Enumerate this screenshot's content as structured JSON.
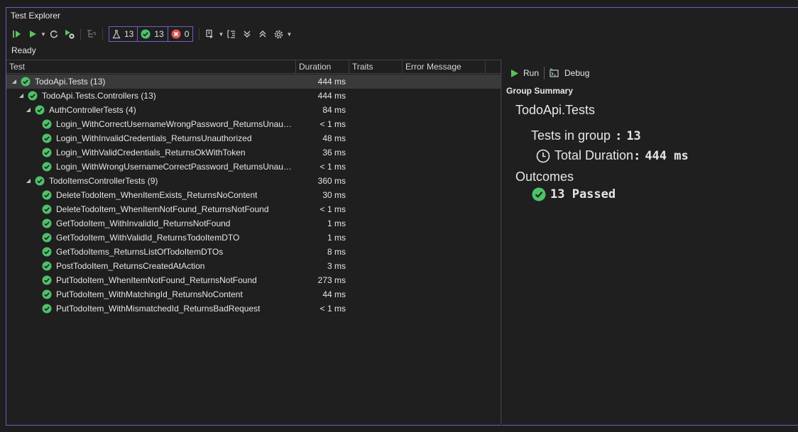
{
  "window": {
    "title": "Test Explorer"
  },
  "toolbar": {
    "counts": {
      "total": "13",
      "passed": "13",
      "failed": "0"
    }
  },
  "status": "Ready",
  "columns": {
    "test": "Test",
    "duration": "Duration",
    "traits": "Traits",
    "error": "Error Message"
  },
  "tree": [
    {
      "name": "TodoApi.Tests (13)",
      "duration": "444 ms",
      "level": 0,
      "expandable": true,
      "selected": true
    },
    {
      "name": "TodoApi.Tests.Controllers (13)",
      "duration": "444 ms",
      "level": 1,
      "expandable": true
    },
    {
      "name": "AuthControllerTests (4)",
      "duration": "84 ms",
      "level": 2,
      "expandable": true
    },
    {
      "name": "Login_WithCorrectUsernameWrongPassword_ReturnsUnauth...",
      "duration": "< 1 ms",
      "level": 3
    },
    {
      "name": "Login_WithInvalidCredentials_ReturnsUnauthorized",
      "duration": "48 ms",
      "level": 3
    },
    {
      "name": "Login_WithValidCredentials_ReturnsOkWithToken",
      "duration": "36 ms",
      "level": 3
    },
    {
      "name": "Login_WithWrongUsernameCorrectPassword_ReturnsUnauth...",
      "duration": "< 1 ms",
      "level": 3
    },
    {
      "name": "TodoItemsControllerTests (9)",
      "duration": "360 ms",
      "level": 2,
      "expandable": true
    },
    {
      "name": "DeleteTodoItem_WhenItemExists_ReturnsNoContent",
      "duration": "30 ms",
      "level": 3
    },
    {
      "name": "DeleteTodoItem_WhenItemNotFound_ReturnsNotFound",
      "duration": "< 1 ms",
      "level": 3
    },
    {
      "name": "GetTodoItem_WithInvalidId_ReturnsNotFound",
      "duration": "1 ms",
      "level": 3
    },
    {
      "name": "GetTodoItem_WithValidId_ReturnsTodoItemDTO",
      "duration": "1 ms",
      "level": 3
    },
    {
      "name": "GetTodoItems_ReturnsListOfTodoItemDTOs",
      "duration": "8 ms",
      "level": 3
    },
    {
      "name": "PostTodoItem_ReturnsCreatedAtAction",
      "duration": "3 ms",
      "level": 3
    },
    {
      "name": "PutTodoItem_WhenItemNotFound_ReturnsNotFound",
      "duration": "273 ms",
      "level": 3
    },
    {
      "name": "PutTodoItem_WithMatchingId_ReturnsNoContent",
      "duration": "44 ms",
      "level": 3
    },
    {
      "name": "PutTodoItem_WithMismatchedId_ReturnsBadRequest",
      "duration": "< 1 ms",
      "level": 3
    }
  ],
  "details": {
    "run_label": "Run",
    "debug_label": "Debug",
    "group_summary_label": "Group Summary",
    "group_name": "TodoApi.Tests",
    "tests_in_group_label": "Tests in group",
    "tests_in_group_value": "13",
    "total_duration_label": "Total Duration",
    "total_duration_value": "444 ms",
    "outcomes_label": "Outcomes",
    "passed_label": "13 Passed"
  },
  "colors": {
    "accent": "#6e5ec7",
    "pass": "#4ec26a",
    "fail": "#e05252",
    "run": "#5cc05c"
  }
}
